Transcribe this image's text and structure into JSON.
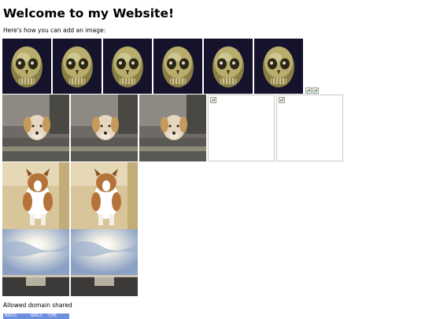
{
  "page": {
    "heading": "Welcome to my Website!",
    "intro": "Here's how you can add an image:",
    "caption": "Allowed domain shared",
    "banner_text": "MADID      WORLD  TIME"
  },
  "images": {
    "skull_row": {
      "subject": "golden-skull",
      "count": 6
    },
    "dog_row": {
      "subject": "dog-on-couch",
      "count": 3,
      "broken_count": 2
    },
    "jumping_dog_row": {
      "subject": "jumping-dog",
      "count": 2
    },
    "sunset_row": {
      "subject": "ocean-sunset",
      "count": 2
    }
  },
  "colors": {
    "background": "#ffffff",
    "text": "#000000",
    "banner": "#6d8fe0",
    "broken_border": "#c8c8c8"
  }
}
